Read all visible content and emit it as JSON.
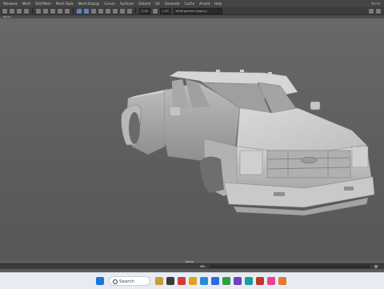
{
  "menubar": {
    "items": [
      "Windows",
      "Mesh",
      "Edit Mesh",
      "Mesh Tools",
      "Mesh Display",
      "Curves",
      "Surfaces",
      "Deform",
      "UV",
      "Generate",
      "Cache",
      "Arnold",
      "Help"
    ],
    "workspace": "Works"
  },
  "toolbar": {
    "field_1": "0.00",
    "field_2": "1.00",
    "color_space": "sRGB gamma (legacy)"
  },
  "panel": {
    "label": "Panels"
  },
  "viewport": {
    "camera": "persp"
  },
  "cmdline": {
    "lang": "MEL"
  },
  "taskbar": {
    "search_label": "Search"
  },
  "colors": {
    "viewport_bg": "#5e5e5e",
    "model": "#c8c8c8",
    "taskbar": "#e8ecf2"
  }
}
